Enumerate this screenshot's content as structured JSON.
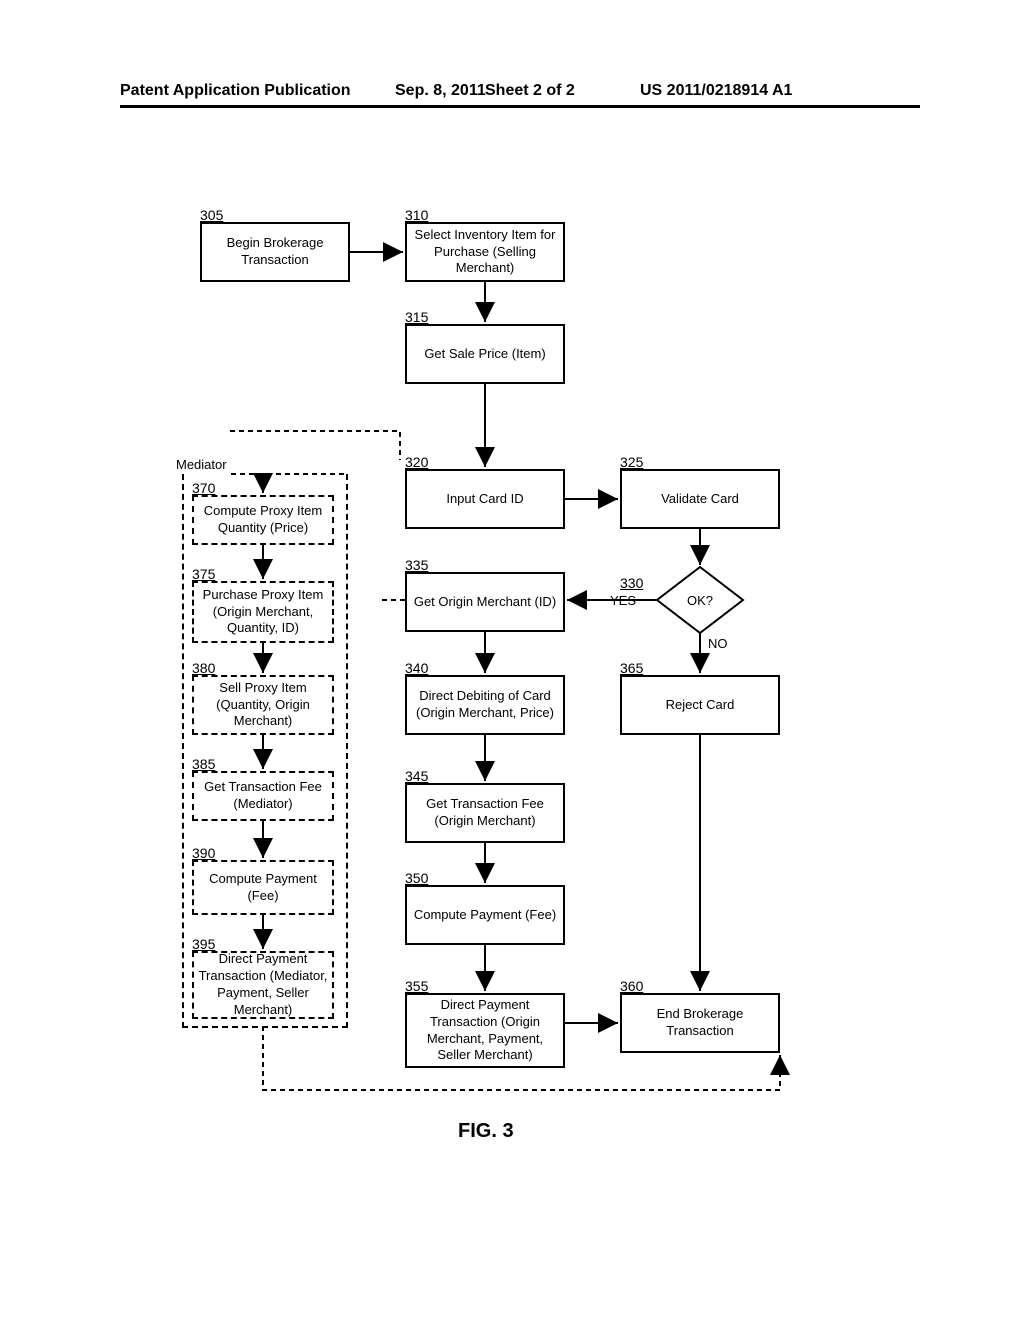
{
  "header": {
    "left": "Patent Application Publication",
    "date": "Sep. 8, 2011",
    "sheet": "Sheet 2 of 2",
    "pubno": "US 2011/0218914 A1"
  },
  "figure_label": "FIG. 3",
  "refs": {
    "r305": "305",
    "r310": "310",
    "r315": "315",
    "r320": "320",
    "r325": "325",
    "r330": "330",
    "r335": "335",
    "r340": "340",
    "r345": "345",
    "r350": "350",
    "r355": "355",
    "r360": "360",
    "r365": "365",
    "r370": "370",
    "r375": "375",
    "r380": "380",
    "r385": "385",
    "r390": "390",
    "r395": "395"
  },
  "boxes": {
    "b305": "Begin Brokerage Transaction",
    "b310": "Select Inventory Item for Purchase (Selling Merchant)",
    "b315": "Get Sale Price (Item)",
    "b320": "Input Card ID",
    "b325": "Validate Card",
    "b335": "Get Origin Merchant (ID)",
    "b340": "Direct Debiting of Card (Origin Merchant, Price)",
    "b345": "Get Transaction Fee (Origin Merchant)",
    "b350": "Compute Payment (Fee)",
    "b355": "Direct Payment Transaction (Origin Merchant, Payment, Seller Merchant)",
    "b360": "End Brokerage Transaction",
    "b365": "Reject Card",
    "b370": "Compute Proxy Item Quantity (Price)",
    "b375": "Purchase Proxy Item (Origin Merchant, Quantity, ID)",
    "b380": "Sell Proxy Item (Quantity, Origin Merchant)",
    "b385": "Get Transaction Fee (Mediator)",
    "b390": "Compute Payment (Fee)",
    "b395": "Direct Payment Transaction (Mediator, Payment, Seller Merchant)"
  },
  "decision": {
    "d330": "OK?",
    "yes": "YES",
    "no": "NO"
  },
  "mediator_label": "Mediator"
}
